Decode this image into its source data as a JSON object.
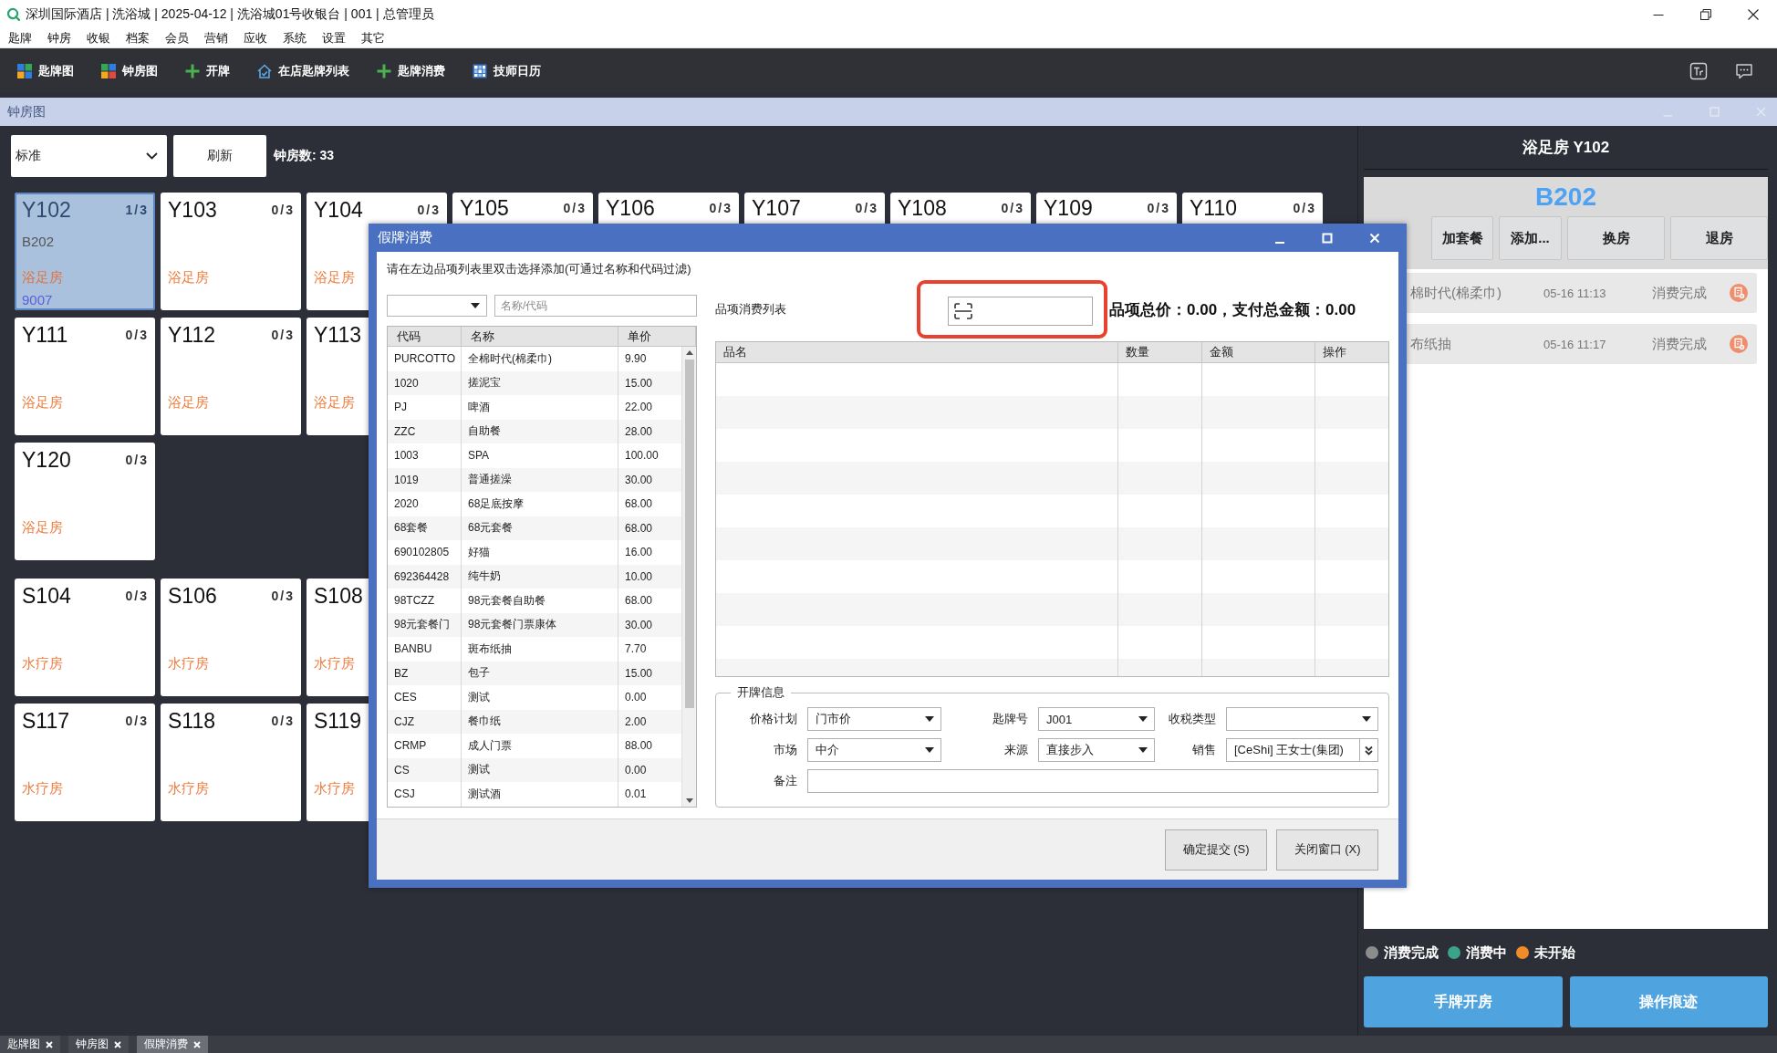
{
  "window": {
    "title": "深圳国际酒店 | 洗浴城 | 2025-04-12 | 洗浴城01号收银台 | 001 | 总管理员"
  },
  "menu": [
    "匙牌",
    "钟房",
    "收银",
    "档案",
    "会员",
    "营销",
    "应收",
    "系统",
    "设置",
    "其它"
  ],
  "toolbar": {
    "items": [
      "匙牌图",
      "钟房图",
      "开牌",
      "在店匙牌列表",
      "匙牌消费",
      "技师日历"
    ]
  },
  "panel": {
    "title": "钟房图"
  },
  "room_view": {
    "filter": {
      "value": "标准"
    },
    "refresh": "刷新",
    "count": "钟房数: 33",
    "groups": [
      {
        "rows": [
          [
            {
              "name": "Y102",
              "count": "1/3",
              "card": "B202",
              "type": "浴足房",
              "code": "9007",
              "selected": true
            },
            {
              "name": "Y103",
              "count": "0/3",
              "type": "浴足房",
              "selected": false
            },
            {
              "name": "Y104",
              "count": "0/3",
              "type": "浴足房",
              "selected": false
            },
            {
              "name": "Y105",
              "count": "0/3",
              "selected": false
            },
            {
              "name": "Y106",
              "count": "0/3",
              "selected": false
            },
            {
              "name": "Y107",
              "count": "0/3",
              "selected": false
            },
            {
              "name": "Y108",
              "count": "0/3",
              "selected": false
            },
            {
              "name": "Y109",
              "count": "0/3",
              "selected": false
            },
            {
              "name": "Y110",
              "count": "0/3",
              "selected": false
            }
          ],
          [
            {
              "name": "Y111",
              "count": "0/3",
              "type": "浴足房",
              "selected": false
            },
            {
              "name": "Y112",
              "count": "0/3",
              "type": "浴足房",
              "selected": false
            },
            {
              "name": "Y113",
              "type": "浴足房",
              "selected": false
            }
          ],
          [
            {
              "name": "Y120",
              "count": "0/3",
              "type": "浴足房",
              "selected": false
            }
          ]
        ]
      },
      {
        "rows": [
          [
            {
              "name": "S104",
              "count": "0/3",
              "type": "水疗房",
              "selected": false
            },
            {
              "name": "S106",
              "count": "0/3",
              "type": "水疗房",
              "selected": false
            },
            {
              "name": "S108",
              "type": "水疗房",
              "selected": false
            }
          ],
          [
            {
              "name": "S117",
              "count": "0/3",
              "type": "水疗房",
              "selected": false
            },
            {
              "name": "S118",
              "count": "0/3",
              "type": "水疗房",
              "selected": false
            },
            {
              "name": "S119",
              "type": "水疗房",
              "selected": false
            }
          ]
        ]
      }
    ]
  },
  "room_panel": {
    "title": "浴足房 Y102",
    "card": "B202",
    "actions": [
      "加套餐",
      "添加...",
      "换房",
      "退房"
    ],
    "items": [
      {
        "name": "棉时代(棉柔巾)",
        "time": "05-16 11:13",
        "status": "消费完成"
      },
      {
        "name": "布纸抽",
        "time": "05-16 11:17",
        "status": "消费完成"
      }
    ],
    "legend": [
      {
        "label": "消费完成",
        "color": "#8c8c8c"
      },
      {
        "label": "消费中",
        "color": "#3aa38a"
      },
      {
        "label": "未开始",
        "color": "#f28c28"
      }
    ],
    "buttons": [
      "手牌开房",
      "操作痕迹"
    ]
  },
  "tabs": [
    {
      "label": "匙牌图",
      "selected": false
    },
    {
      "label": "钟房图",
      "selected": false
    },
    {
      "label": "假牌消费",
      "selected": true
    }
  ],
  "dialog": {
    "title": "假牌消费",
    "instruction": "请在左边品项列表里双击选择添加(可通过名称和代码过滤)",
    "search": {
      "placeholder": "名称/代码"
    },
    "items_table": {
      "columns": [
        "代码",
        "名称",
        "单价"
      ],
      "rows": [
        [
          "PURCOTTO",
          "全棉时代(棉柔巾)",
          "9.90"
        ],
        [
          "1020",
          "搓泥宝",
          "15.00"
        ],
        [
          "PJ",
          "啤酒",
          "22.00"
        ],
        [
          "ZZC",
          "自助餐",
          "28.00"
        ],
        [
          "1003",
          "SPA",
          "100.00"
        ],
        [
          "1019",
          "普通搓澡",
          "30.00"
        ],
        [
          "2020",
          "68足底按摩",
          "68.00"
        ],
        [
          "68套餐",
          "68元套餐",
          "68.00"
        ],
        [
          "690102805",
          "好猫",
          "16.00"
        ],
        [
          "692364428",
          "纯牛奶",
          "10.00"
        ],
        [
          "98TCZZ",
          "98元套餐自助餐",
          "68.00"
        ],
        [
          "98元套餐门",
          "98元套餐门票康体",
          "30.00"
        ],
        [
          "BANBU",
          "斑布纸抽",
          "7.70"
        ],
        [
          "BZ",
          "包子",
          "15.00"
        ],
        [
          "CES",
          "测试",
          "0.00"
        ],
        [
          "CJZ",
          "餐巾纸",
          "2.00"
        ],
        [
          "CRMP",
          "成人门票",
          "88.00"
        ],
        [
          "CS",
          "测试",
          "0.00"
        ],
        [
          "CSJ",
          "测试酒",
          "0.01"
        ]
      ]
    },
    "consumption": {
      "label": "品项消费列表",
      "summary": "品项总价：0.00，支付总金额：0.00",
      "columns": [
        "品名",
        "数量",
        "金额",
        "操作"
      ]
    },
    "open_info": {
      "legend": "开牌信息",
      "fields": [
        {
          "label": "价格计划",
          "value": "门市价",
          "kind": "select"
        },
        {
          "label": "匙牌号",
          "value": "J001",
          "kind": "select"
        },
        {
          "label": "收税类型",
          "kind": "select"
        },
        {
          "label": "市场",
          "value": "中介",
          "kind": "select"
        },
        {
          "label": "来源",
          "value": "直接步入",
          "kind": "select"
        },
        {
          "label": "销售",
          "value": "[CeShi] 王女士(集团)",
          "kind": "picker"
        },
        {
          "label": "备注",
          "kind": "text"
        }
      ]
    },
    "buttons": [
      "确定提交 (S)",
      "关闭窗口 (X)"
    ]
  }
}
